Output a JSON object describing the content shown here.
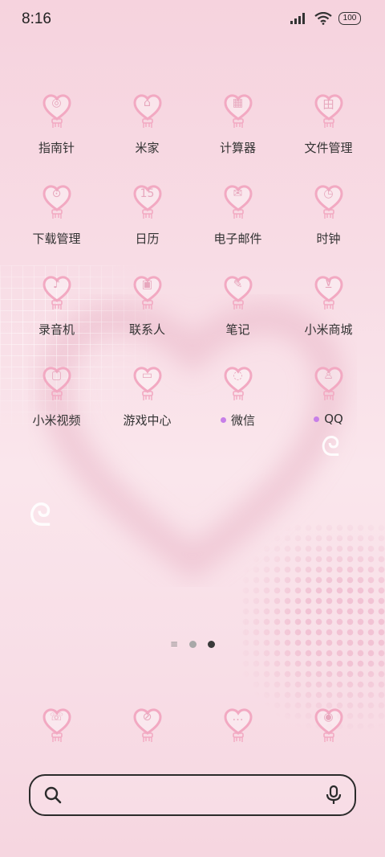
{
  "status_bar": {
    "time": "8:16",
    "battery": "100"
  },
  "apps": [
    {
      "label": "指南针",
      "glyph": "◎",
      "new": false
    },
    {
      "label": "米家",
      "glyph": "⌂",
      "new": false
    },
    {
      "label": "计算器",
      "glyph": "▦",
      "new": false
    },
    {
      "label": "文件管理",
      "glyph": "田",
      "new": false
    },
    {
      "label": "下载管理",
      "glyph": "⊙",
      "new": false
    },
    {
      "label": "日历",
      "glyph": "15",
      "new": false
    },
    {
      "label": "电子邮件",
      "glyph": "✉",
      "new": false
    },
    {
      "label": "时钟",
      "glyph": "◷",
      "new": false
    },
    {
      "label": "录音机",
      "glyph": "♪",
      "new": false
    },
    {
      "label": "联系人",
      "glyph": "▣",
      "new": false
    },
    {
      "label": "笔记",
      "glyph": "✎",
      "new": false
    },
    {
      "label": "小米商城",
      "glyph": "⊻",
      "new": false
    },
    {
      "label": "小米视频",
      "glyph": "▢",
      "new": false
    },
    {
      "label": "游戏中心",
      "glyph": "▭",
      "new": false
    },
    {
      "label": "微信",
      "glyph": "◌",
      "new": true
    },
    {
      "label": "QQ",
      "glyph": "♙",
      "new": true
    }
  ],
  "dock": [
    {
      "name": "phone",
      "glyph": "☏"
    },
    {
      "name": "browser",
      "glyph": "⊘"
    },
    {
      "name": "messages",
      "glyph": "…"
    },
    {
      "name": "camera",
      "glyph": "◉"
    }
  ],
  "pager": {
    "menu_glyph": "≡",
    "pages": 2,
    "active_page": 2
  },
  "colors": {
    "accent": "#f2a9c2",
    "new_dot": "#c77fe8",
    "text": "#333333"
  }
}
